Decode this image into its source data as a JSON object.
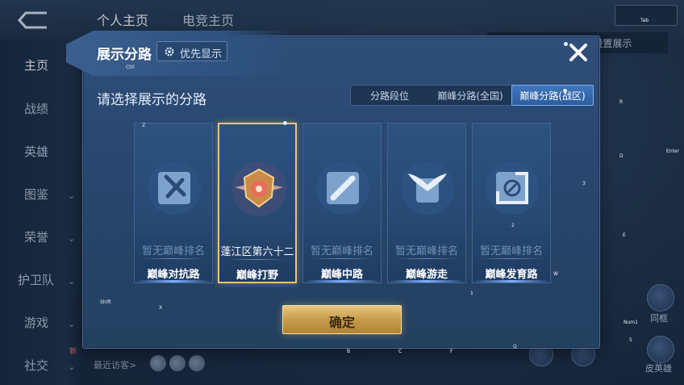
{
  "background": {
    "top_tabs": [
      "个人主页",
      "电竞主页"
    ],
    "sidebar": [
      {
        "label": "主页",
        "active": true,
        "chevron": false
      },
      {
        "label": "战绩",
        "active": false,
        "chevron": false
      },
      {
        "label": "英雄",
        "active": false,
        "chevron": false
      },
      {
        "label": "图鉴",
        "active": false,
        "chevron": true
      },
      {
        "label": "荣誉",
        "active": false,
        "chevron": true
      },
      {
        "label": "护卫队",
        "active": false,
        "chevron": true
      },
      {
        "label": "游戏",
        "active": false,
        "chevron": true
      },
      {
        "label": "社交",
        "active": false,
        "chevron": true
      }
    ],
    "new_badge": "新",
    "visitors_label": "最近访客>",
    "top_right_banner": "(秒)设置展示",
    "right_labels": [
      "同框",
      "皮英雄"
    ]
  },
  "dialog": {
    "title": "展示分路",
    "priority_button": "优先显示",
    "subtitle": "请选择展示的分路",
    "tabs": [
      {
        "label": "分路段位",
        "active": false
      },
      {
        "label": "巅峰分路(全国)",
        "active": false
      },
      {
        "label": "巅峰分路(战区)",
        "active": true
      }
    ],
    "cards": [
      {
        "rank": "暂无巅峰排名",
        "lane": "巅峰对抗路",
        "selected": false,
        "icon": "crossed-swords-icon"
      },
      {
        "rank": "蓬江区第六十二",
        "lane": "巅峰打野",
        "selected": true,
        "icon": "jungle-badge-icon"
      },
      {
        "rank": "暂无巅峰排名",
        "lane": "巅峰中路",
        "selected": false,
        "icon": "mid-lane-icon"
      },
      {
        "rank": "暂无巅峰排名",
        "lane": "巅峰游走",
        "selected": false,
        "icon": "wings-icon"
      },
      {
        "rank": "暂无巅峰排名",
        "lane": "巅峰发育路",
        "selected": false,
        "icon": "farm-lane-icon"
      }
    ],
    "confirm_label": "确定"
  },
  "key_hints": [
    "Z",
    "X",
    "C",
    "B",
    "F",
    "Q",
    "E",
    "W",
    "R",
    "D",
    "3",
    "2",
    "1",
    "5",
    "Tab",
    "Enter",
    "Num1",
    "Ctrl",
    "Shift"
  ],
  "colors": {
    "accent_gold": "#e8c37b",
    "active_tab": "#3f76bb",
    "panel": "#294770"
  }
}
